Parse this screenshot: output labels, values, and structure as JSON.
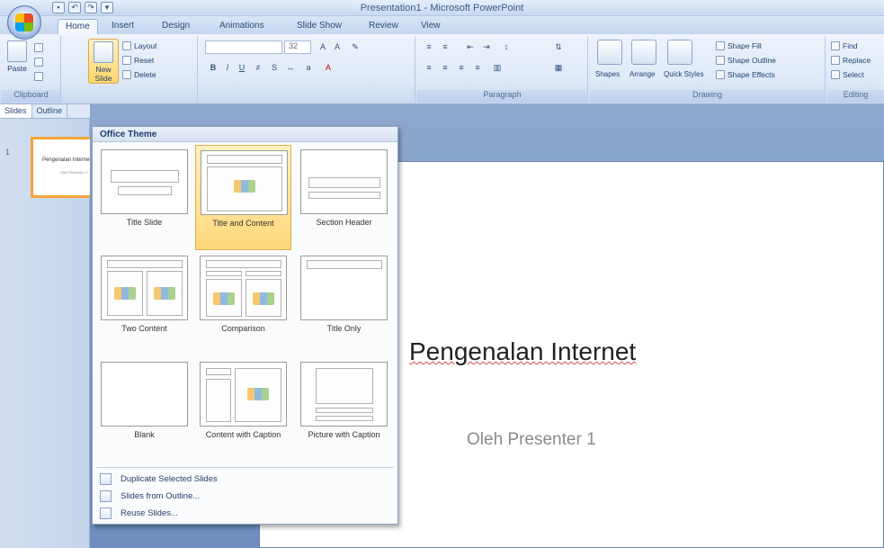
{
  "window": {
    "title": "Presentation1 - Microsoft PowerPoint"
  },
  "quick_access": {
    "icons": [
      "save-icon",
      "undo-icon",
      "redo-icon",
      "customize-icon"
    ]
  },
  "tabs": [
    {
      "label": "Home",
      "active": true
    },
    {
      "label": "Insert"
    },
    {
      "label": "Design"
    },
    {
      "label": "Animations"
    },
    {
      "label": "Slide Show"
    },
    {
      "label": "Review"
    },
    {
      "label": "View"
    }
  ],
  "ribbon": {
    "clipboard": {
      "label": "Clipboard",
      "paste": "Paste"
    },
    "slides": {
      "new_slide": "New Slide",
      "layout": "Layout",
      "reset": "Reset",
      "delete": "Delete"
    },
    "font": {
      "size_value": "32"
    },
    "paragraph": {
      "label": "Paragraph"
    },
    "drawing": {
      "label": "Drawing",
      "shapes": "Shapes",
      "arrange": "Arrange",
      "quick_styles": "Quick Styles",
      "shape_fill": "Shape Fill",
      "shape_outline": "Shape Outline",
      "shape_effects": "Shape Effects"
    },
    "editing": {
      "label": "Editing",
      "find": "Find",
      "replace": "Replace",
      "select": "Select"
    }
  },
  "left_pane": {
    "tabs": [
      "Slides",
      "Outline"
    ],
    "thumbnail_number": "1"
  },
  "slide": {
    "title": "Pengenalan Internet",
    "subtitle": "Oleh Presenter 1"
  },
  "dropdown": {
    "header": "Office Theme",
    "layouts": [
      {
        "label": "Title Slide"
      },
      {
        "label": "Title and Content",
        "selected": true
      },
      {
        "label": "Section Header"
      },
      {
        "label": "Two Content"
      },
      {
        "label": "Comparison"
      },
      {
        "label": "Title Only"
      },
      {
        "label": "Blank"
      },
      {
        "label": "Content with Caption"
      },
      {
        "label": "Picture with Caption"
      }
    ],
    "menu_items": [
      "Duplicate Selected Slides",
      "Slides from Outline...",
      "Reuse Slides..."
    ]
  },
  "colors": {
    "accent_highlight": "#ffd46a",
    "slide_background": "#ffffff",
    "workspace": "#7f9cc8"
  }
}
